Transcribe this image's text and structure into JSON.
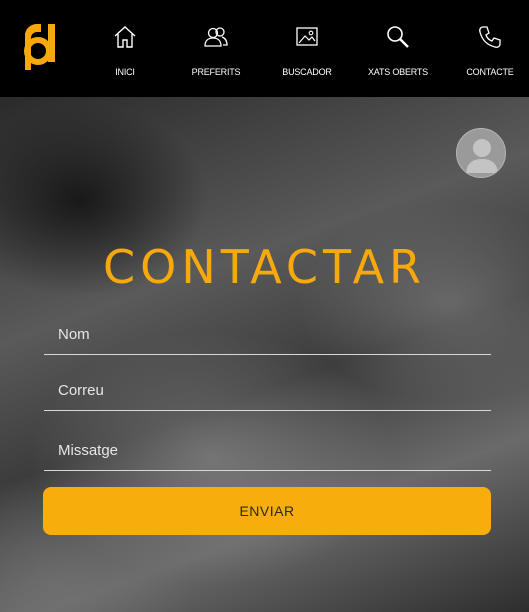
{
  "brand": {
    "accent": "#f7a80a",
    "logo": "pd-logo"
  },
  "nav": {
    "items": [
      {
        "label": "INICI",
        "icon": "home-icon"
      },
      {
        "label": "PREFERITS",
        "icon": "users-icon"
      },
      {
        "label": "BUSCADOR",
        "icon": "image-icon"
      },
      {
        "label": "XATS OBERTS",
        "icon": "search-icon"
      },
      {
        "label": "CONTACTE",
        "icon": "phone-icon"
      }
    ]
  },
  "user": {
    "avatar_icon": "user-avatar-icon"
  },
  "form": {
    "title": "CONTACTAR",
    "name_placeholder": "Nom",
    "email_placeholder": "Correu",
    "message_placeholder": "Missatge",
    "submit_label": "ENVIAR"
  }
}
